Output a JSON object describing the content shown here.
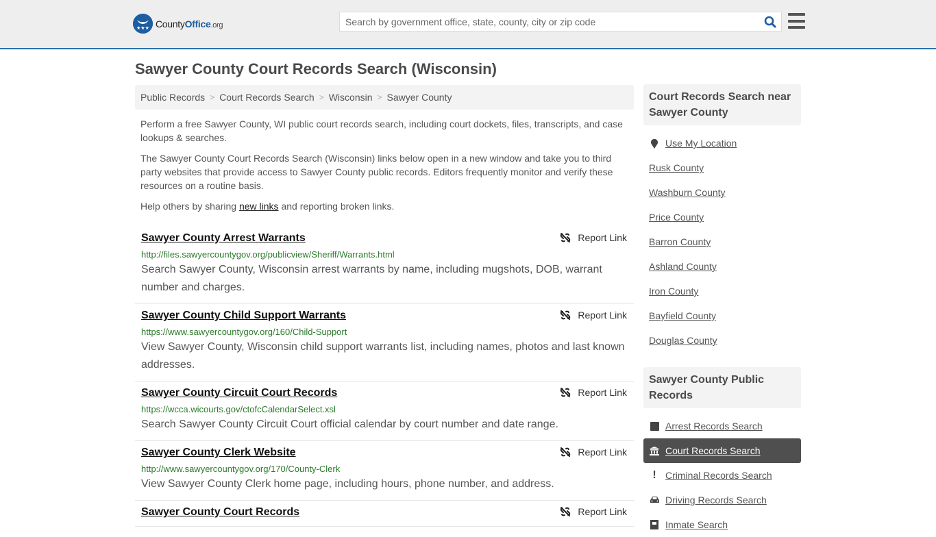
{
  "header": {
    "logo": {
      "name_part1": "County",
      "name_part2": "Office",
      "name_part3": ".org"
    },
    "search": {
      "placeholder": "Search by government office, state, county, city or zip code",
      "value": ""
    }
  },
  "page": {
    "title": "Sawyer County Court Records Search (Wisconsin)"
  },
  "breadcrumb": [
    "Public Records",
    "Court Records Search",
    "Wisconsin",
    "Sawyer County"
  ],
  "intro": {
    "p1": "Perform a free Sawyer County, WI public court records search, including court dockets, files, transcripts, and case lookups & searches.",
    "p2": "The Sawyer County Court Records Search (Wisconsin) links below open in a new window and take you to third party websites that provide access to Sawyer County public records. Editors frequently monitor and verify these resources on a routine basis.",
    "p3_before": "Help others by sharing ",
    "p3_link": "new links",
    "p3_after": " and reporting broken links."
  },
  "report_label": "Report Link",
  "results": [
    {
      "title": "Sawyer County Arrest Warrants",
      "url": "http://files.sawyercountygov.org/publicview/Sheriff/Warrants.html",
      "desc": "Search Sawyer County, Wisconsin arrest warrants by name, including mugshots, DOB, warrant number and charges."
    },
    {
      "title": "Sawyer County Child Support Warrants",
      "url": "https://www.sawyercountygov.org/160/Child-Support",
      "desc": "View Sawyer County, Wisconsin child support warrants list, including names, photos and last known addresses."
    },
    {
      "title": "Sawyer County Circuit Court Records",
      "url": "https://wcca.wicourts.gov/ctofcCalendarSelect.xsl",
      "desc": "Search Sawyer County Circuit Court official calendar by court number and date range."
    },
    {
      "title": "Sawyer County Clerk Website",
      "url": "http://www.sawyercountygov.org/170/County-Clerk",
      "desc": "View Sawyer County Clerk home page, including hours, phone number, and address."
    },
    {
      "title": "Sawyer County Court Records",
      "url": "",
      "desc": ""
    }
  ],
  "sidebar": {
    "nearby": {
      "heading": "Court Records Search near Sawyer County",
      "use_location": "Use My Location",
      "counties": [
        "Rusk County",
        "Washburn County",
        "Price County",
        "Barron County",
        "Ashland County",
        "Iron County",
        "Bayfield County",
        "Douglas County"
      ]
    },
    "public_records": {
      "heading": "Sawyer County Public Records",
      "items": [
        {
          "label": "Arrest Records Search",
          "icon": "square-icon",
          "active": false
        },
        {
          "label": "Court Records Search",
          "icon": "courthouse-icon",
          "active": true
        },
        {
          "label": "Criminal Records Search",
          "icon": "exclamation-icon",
          "active": false
        },
        {
          "label": "Driving Records Search",
          "icon": "car-icon",
          "active": false
        },
        {
          "label": "Inmate Search",
          "icon": "inmate-icon",
          "active": false
        }
      ]
    }
  }
}
